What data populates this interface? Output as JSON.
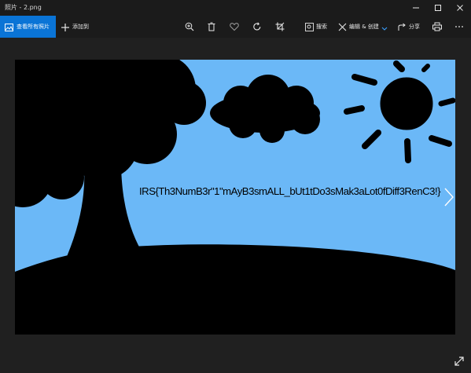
{
  "window": {
    "title": "照片 - 2.png",
    "minimize_icon": "minimize-icon",
    "maximize_icon": "maximize-icon",
    "close_icon": "close-icon"
  },
  "toolbar": {
    "view_all_label": "查看所有照片",
    "add_to_label": "添加到",
    "zoom_icon": "zoom-in-icon",
    "delete_icon": "trash-icon",
    "favorite_icon": "heart-icon",
    "rotate_icon": "rotate-icon",
    "crop_icon": "crop-icon",
    "search_label": "搜索",
    "edit_create_label": "编辑 & 创建",
    "share_label": "分享",
    "print_icon": "printer-icon",
    "more_icon": "more-icon"
  },
  "photo": {
    "embedded_text": "IRS{Th3NumB3r\"1\"mAyB3smALL_bUt1tDo3sMak3aLot0fDiff3RenC3!}",
    "sky_color": "#6bb8f7",
    "silhouette_color": "#000000"
  },
  "viewer": {
    "next_icon": "chevron-right-icon",
    "fullscreen_icon": "expand-icon"
  },
  "colors": {
    "accent": "#0a74d6",
    "chrome_bg": "#1b1b1b",
    "viewer_bg": "#202020"
  }
}
